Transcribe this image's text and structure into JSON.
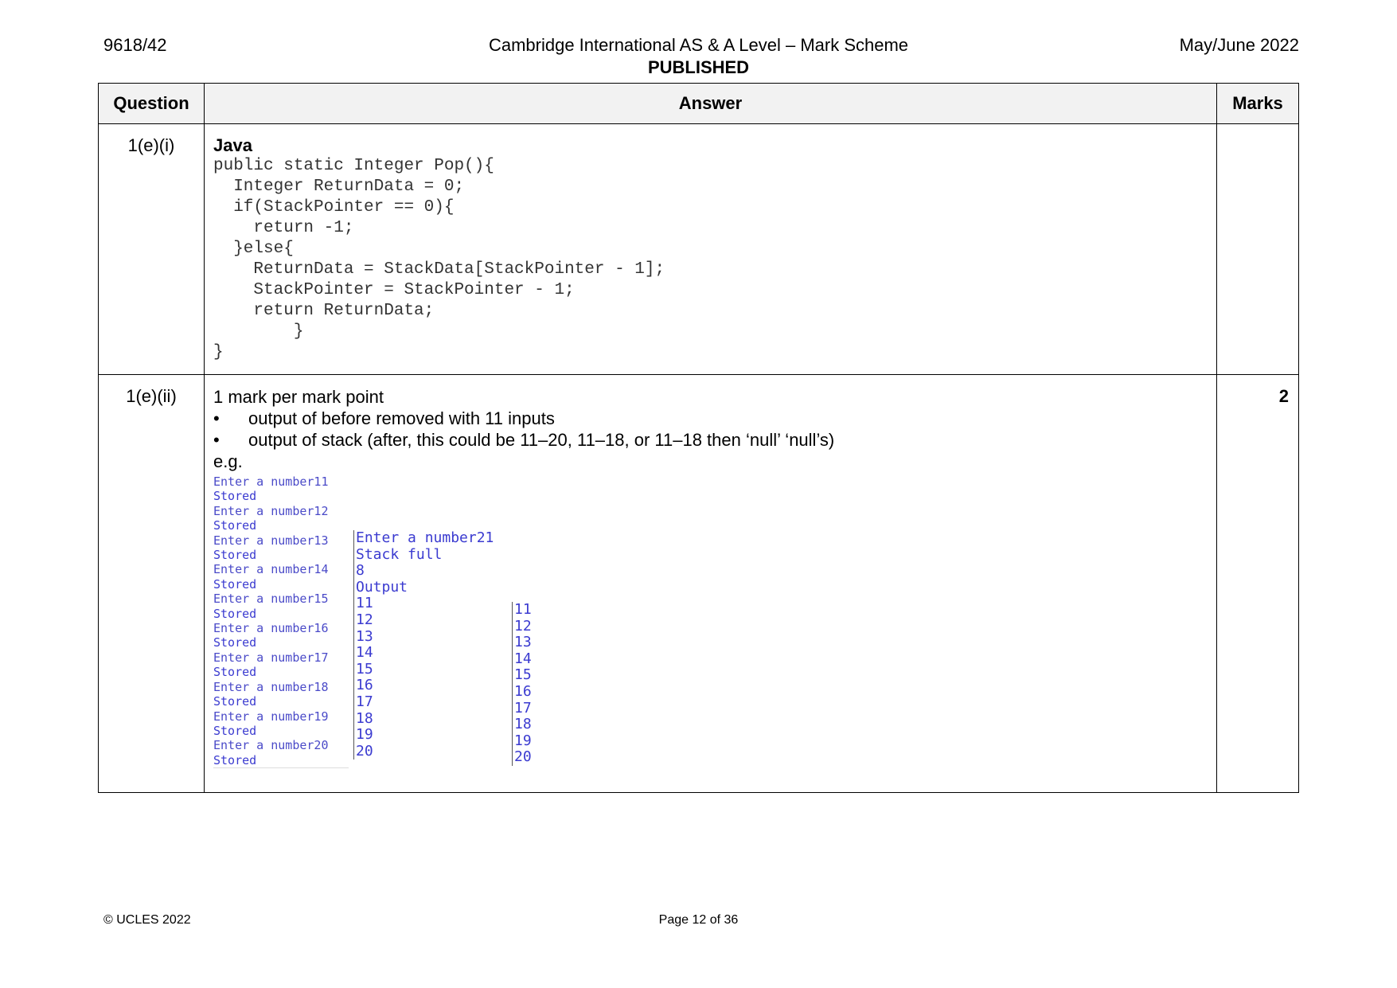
{
  "header": {
    "paper_code": "9618/42",
    "title": "Cambridge International AS & A Level – Mark Scheme",
    "status": "PUBLISHED",
    "session": "May/June 2022"
  },
  "table": {
    "headers": {
      "question": "Question",
      "answer": "Answer",
      "marks": "Marks"
    },
    "rows": [
      {
        "question": "1(e)(i)",
        "language": "Java",
        "code": "public static Integer Pop(){\n  Integer ReturnData = 0;\n  if(StackPointer == 0){\n    return -1;\n  }else{\n    ReturnData = StackData[StackPointer - 1];\n    StackPointer = StackPointer - 1;\n    return ReturnData;\n        }\n}",
        "marks": ""
      },
      {
        "question": "1(e)(ii)",
        "intro": "1 mark per mark point",
        "points": [
          "output of before removed with 11 inputs",
          "output of stack (after, this could be 11–20, 11–18, or 11–18 then ‘null’ ‘null’s)"
        ],
        "example_label": "e.g.",
        "marks": "2",
        "console": {
          "col_a": [
            "Enter a number11",
            "Stored",
            "Enter a number12",
            "Stored",
            "Enter a number13",
            "Stored",
            "Enter a number14",
            "Stored",
            "Enter a number15",
            "Stored",
            "Enter a number16",
            "Stored",
            "Enter a number17",
            "Stored",
            "Enter a number18",
            "Stored",
            "Enter a number19",
            "Stored",
            "Enter a number20",
            "Stored"
          ],
          "col_b": [
            "Enter a number21",
            "Stack full",
            "8",
            "Output",
            "11",
            "12",
            "13",
            "14",
            "15",
            "16",
            "17",
            "18",
            "19",
            "20"
          ],
          "col_c": [
            "11",
            "12",
            "13",
            "14",
            "15",
            "16",
            "17",
            "18",
            "19",
            "20"
          ]
        }
      }
    ]
  },
  "footer": {
    "copyright": "© UCLES 2022",
    "page": "Page 12 of 36"
  }
}
